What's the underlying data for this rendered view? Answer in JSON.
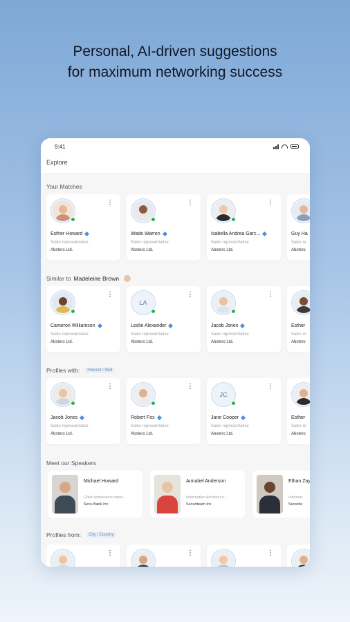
{
  "headline": {
    "line1": "Personal, AI-driven suggestions",
    "line2": "for maximum networking success"
  },
  "status": {
    "time": "9:41"
  },
  "screen": {
    "title": "Explore"
  },
  "sections": {
    "matches": {
      "title": "Your Matches",
      "cards": [
        {
          "name": "Esther Howard",
          "role": "Sales representative",
          "company": "Abstero Ltd."
        },
        {
          "name": "Wade Warren",
          "role": "Sales representative",
          "company": "Abstero Ltd."
        },
        {
          "name": "Isabella Andrea Garc...",
          "role": "Sales representative",
          "company": "Abstero Ltd."
        },
        {
          "name": "Guy Ha",
          "role": "Sales re",
          "company": "Abstero"
        }
      ]
    },
    "similar": {
      "title": "Similar to",
      "person": "Madeleine Brown",
      "cards": [
        {
          "name": "Cameron Williamson",
          "role": "Sales representative",
          "company": "Abstero Ltd."
        },
        {
          "name": "Leslie Alexander",
          "initials": "LA",
          "role": "Sales representative",
          "company": "Abstero Ltd."
        },
        {
          "name": "Jacob Jones",
          "role": "Sales representative",
          "company": "Abstero Ltd."
        },
        {
          "name": "Esther",
          "role": "Sales re",
          "company": "Abstero"
        }
      ]
    },
    "profiles_with": {
      "title": "Profiles with:",
      "chip": "Interest / Skill",
      "cards": [
        {
          "name": "Jacob Jones",
          "role": "Sales representative",
          "company": "Abstero Ltd."
        },
        {
          "name": "Robert Fox",
          "role": "Sales representative",
          "company": "Abstero Ltd."
        },
        {
          "name": "Jane Cooper",
          "initials": "JC",
          "role": "Sales representative",
          "company": "Abstero Ltd."
        },
        {
          "name": "Esther",
          "role": "Sales re",
          "company": "Abstero"
        }
      ]
    },
    "speakers": {
      "title": "Meet our Speakers",
      "cards": [
        {
          "name": "Michael Howard",
          "title": "Chief admissions repre...",
          "company": "Secu Bank Inc."
        },
        {
          "name": "Annabel Anderson",
          "title": "Information Architect a...",
          "company": "Securiteam Inc."
        },
        {
          "name": "Ethan Zayn",
          "title": "Informat",
          "company": "Securite"
        }
      ]
    },
    "profiles_from": {
      "title": "Profiles from:",
      "chip": "City / Country"
    }
  }
}
